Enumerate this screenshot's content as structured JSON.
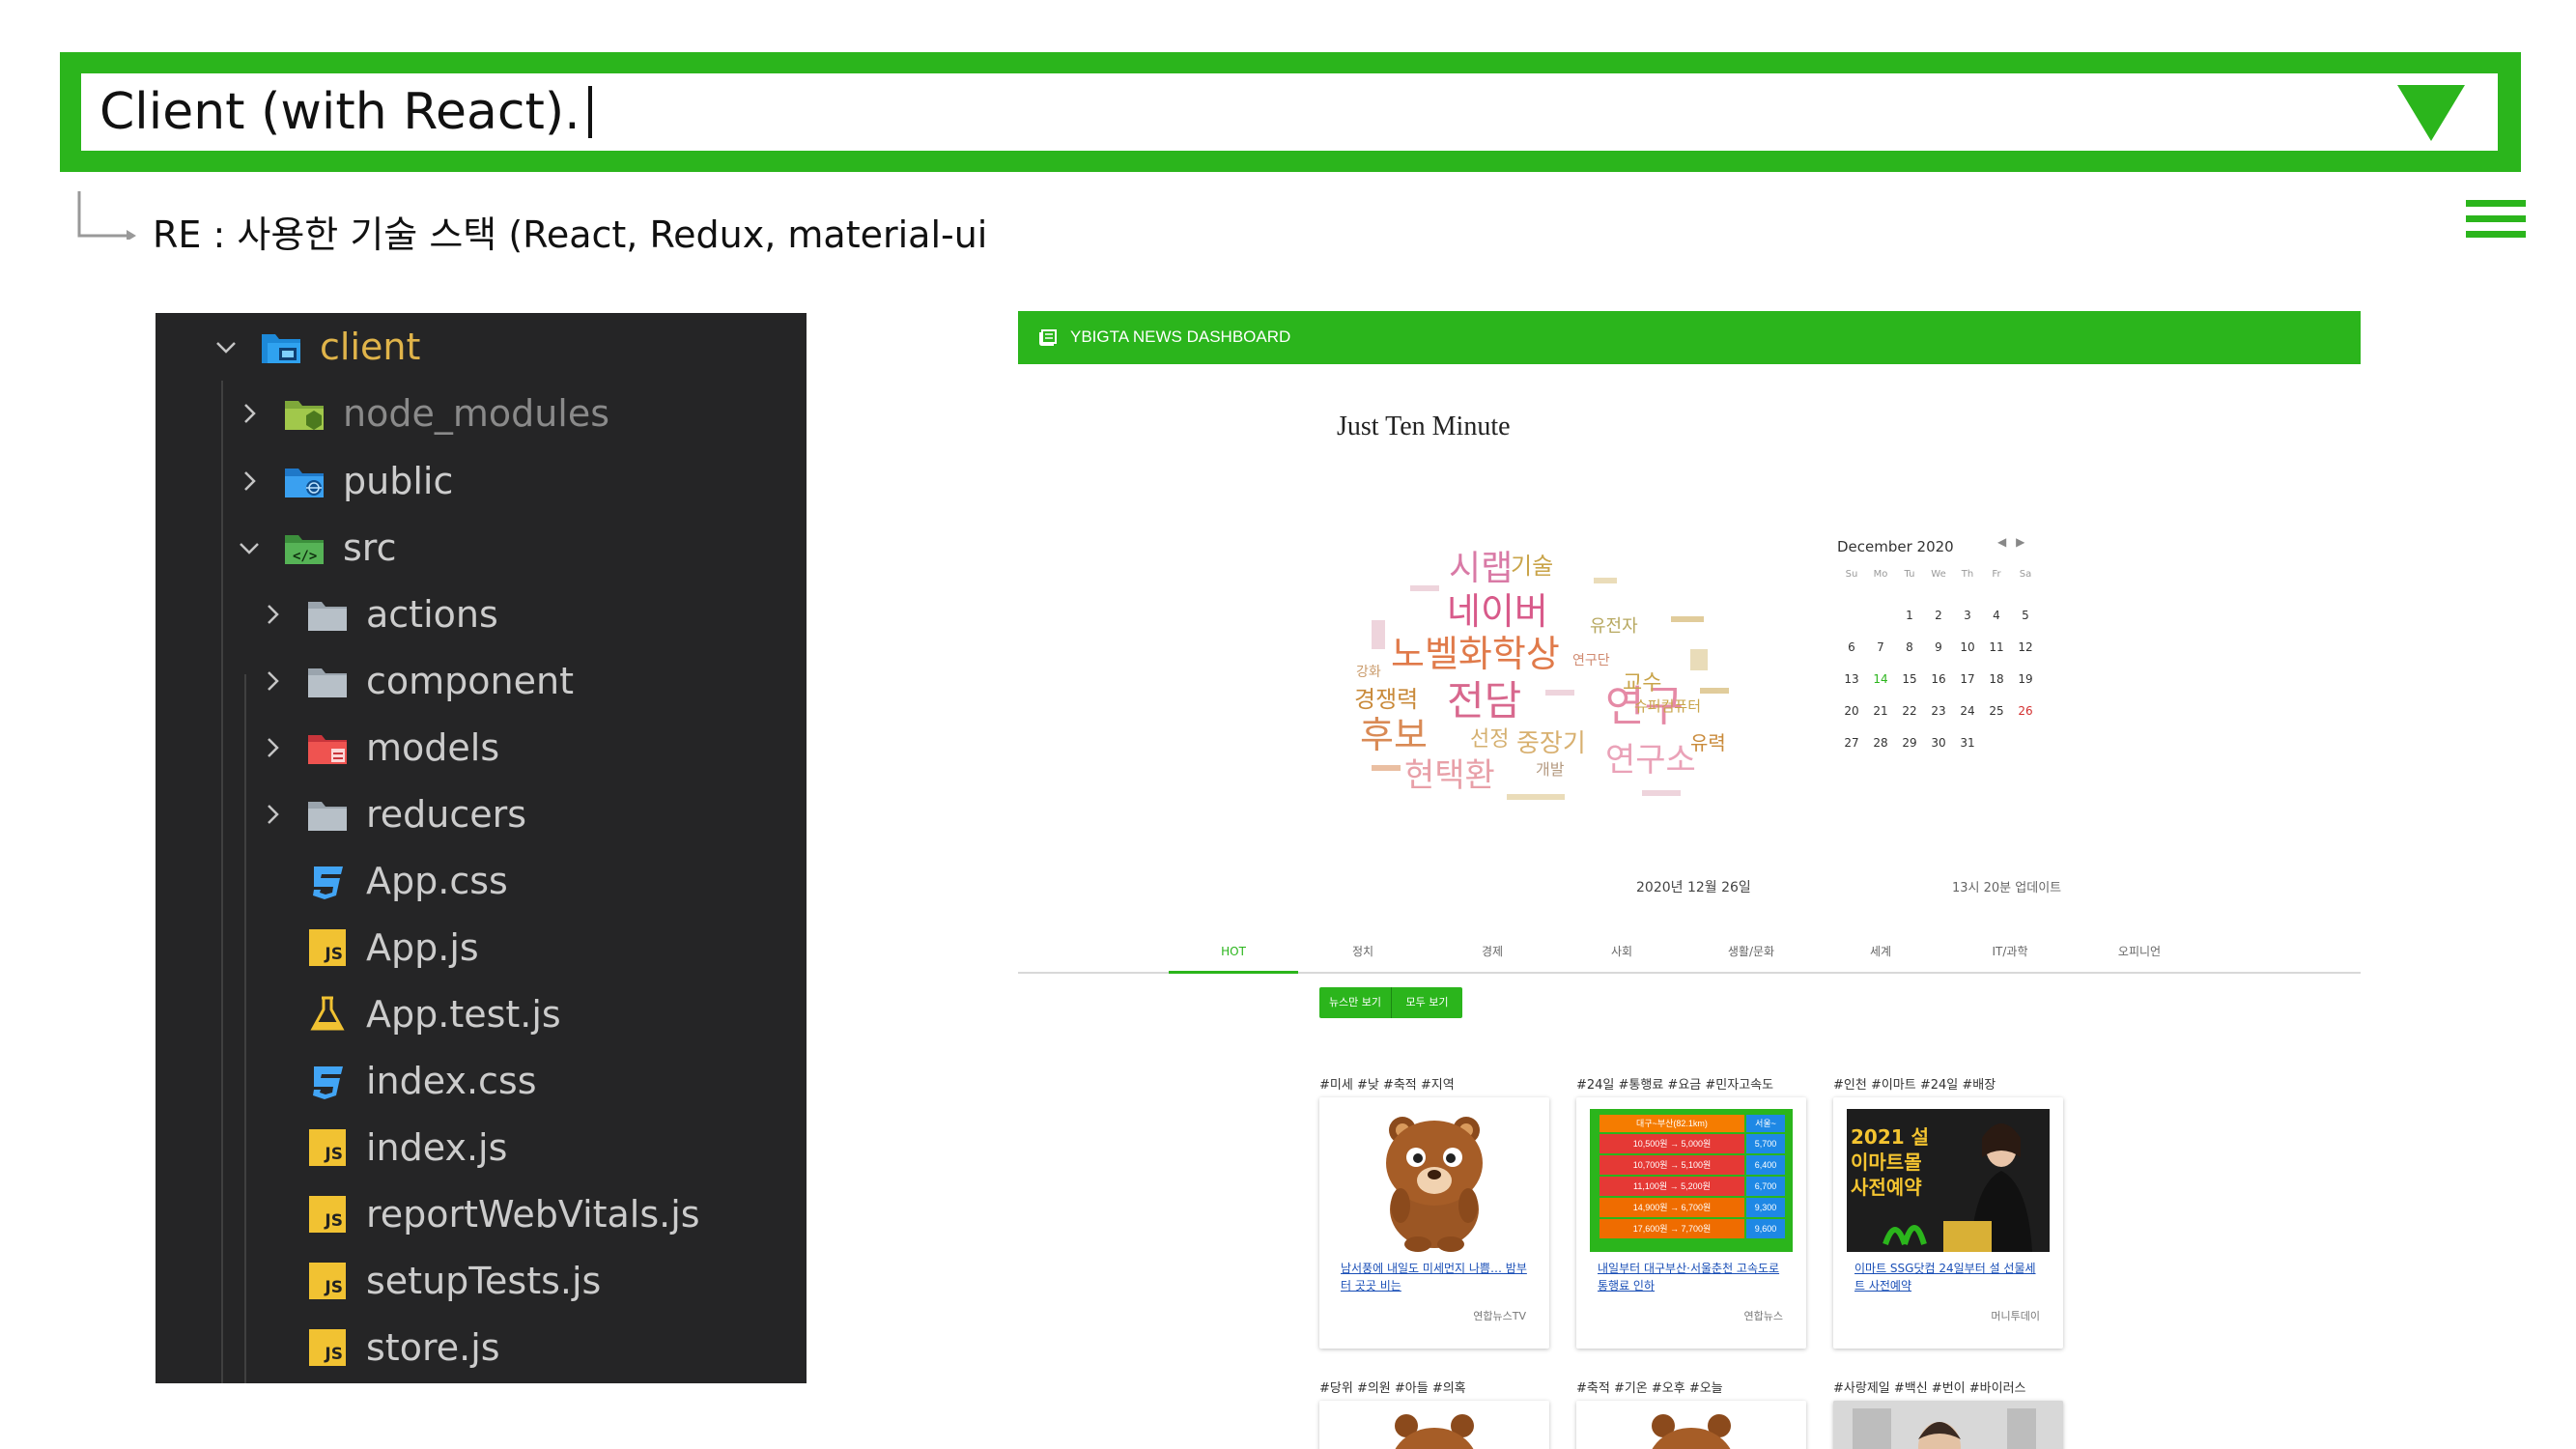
{
  "header": {
    "title": "Client (with React).",
    "subtitle": "RE : 사용한 기술 스택 (React, Redux, material-ui",
    "accent_color": "#2bb51c"
  },
  "explorer": {
    "items": [
      {
        "label": "client",
        "icon": "folder-client-icon",
        "expanded": true
      },
      {
        "label": "node_modules",
        "icon": "folder-node-icon",
        "expanded": false
      },
      {
        "label": "public",
        "icon": "folder-public-icon",
        "expanded": false
      },
      {
        "label": "src",
        "icon": "folder-src-icon",
        "expanded": true
      },
      {
        "label": "actions",
        "icon": "folder-icon",
        "expanded": false
      },
      {
        "label": "component",
        "icon": "folder-icon",
        "expanded": false
      },
      {
        "label": "models",
        "icon": "folder-models-icon",
        "expanded": false
      },
      {
        "label": "reducers",
        "icon": "folder-icon",
        "expanded": false
      },
      {
        "label": "App.css",
        "icon": "css-file-icon"
      },
      {
        "label": "App.js",
        "icon": "js-file-icon",
        "badge": "JS"
      },
      {
        "label": "App.test.js",
        "icon": "test-file-icon"
      },
      {
        "label": "index.css",
        "icon": "css-file-icon"
      },
      {
        "label": "index.js",
        "icon": "js-file-icon",
        "badge": "JS"
      },
      {
        "label": "reportWebVitals.js",
        "icon": "js-file-icon",
        "badge": "JS"
      },
      {
        "label": "setupTests.js",
        "icon": "js-file-icon",
        "badge": "JS"
      },
      {
        "label": "store.js",
        "icon": "js-file-icon",
        "badge": "JS"
      }
    ]
  },
  "dashboard": {
    "app_title": "YBIGTA NEWS DASHBOARD",
    "heading": "Just Ten Minute",
    "wordcloud": {
      "words": [
        "시랩",
        "기술",
        "네이버",
        "노벨화학상",
        "전담",
        "연구",
        "연구소",
        "후보",
        "현택환",
        "경쟁력",
        "교수",
        "중장기",
        "개발",
        "유전자",
        "선정",
        "유력",
        "슈퍼컴퓨터",
        "연구단",
        "강화"
      ]
    },
    "calendar": {
      "title": "December 2020",
      "prev": "◀",
      "next": "▶",
      "weekdays": [
        "Su",
        "Mo",
        "Tu",
        "We",
        "Th",
        "Fr",
        "Sa"
      ],
      "weeks": [
        [
          "",
          "",
          "1",
          "2",
          "3",
          "4",
          "5"
        ],
        [
          "6",
          "7",
          "8",
          "9",
          "10",
          "11",
          "12"
        ],
        [
          "13",
          "14",
          "15",
          "16",
          "17",
          "18",
          "19"
        ],
        [
          "20",
          "21",
          "22",
          "23",
          "24",
          "25",
          "26"
        ],
        [
          "27",
          "28",
          "29",
          "30",
          "31",
          "",
          ""
        ]
      ],
      "today_color": "#2bb51c",
      "selected_color": "#d32f2f"
    },
    "date_text": "2020년 12월 26일",
    "update_text": "13시 20분 업데이트",
    "tabs": [
      "HOT",
      "정치",
      "경제",
      "사회",
      "생활/문화",
      "세계",
      "IT/과학",
      "오피니언"
    ],
    "view_buttons": [
      "뉴스만 보기",
      "모두 보기"
    ],
    "columns": [
      {
        "tags": "#미세 #낮 #축적 #지역",
        "headline": "남서풍에 내일도 미세먼지 나쁨… 밤부터 곳곳 비는",
        "source": "연합뉴스TV",
        "next_tags": "#당위 #의원 #아들 #의혹"
      },
      {
        "tags": "#24일 #통행료 #요금 #민자고속도",
        "headline": "내일부터 대구부산·서울춘천 고속도로 통행료 인하",
        "source": "연합뉴스",
        "toll_table": {
          "header": [
            "대구~부산(82.1km)",
            "서울~"
          ],
          "rows": [
            [
              "10,500원 → 5,000원",
              "5,700"
            ],
            [
              "10,700원 → 5,100원",
              "6,400"
            ],
            [
              "11,100원 → 5,200원",
              "6,700"
            ],
            [
              "14,900원 → 6,700원",
              "9,300"
            ],
            [
              "17,600원 → 7,700원",
              "9,600"
            ]
          ]
        },
        "next_tags": "#축적 #기온 #오후 #오늘"
      },
      {
        "tags": "#인천 #이마트 #24일 #배장",
        "headline": "이마트 SSG닷컴 24일부터 설 선물세트 사전예약",
        "source": "머니투데이",
        "promo": [
          "2021 설",
          "이마트몰",
          "사전예약"
        ],
        "next_tags": "#사랑제일 #백신 #번이 #바이러스"
      }
    ]
  }
}
